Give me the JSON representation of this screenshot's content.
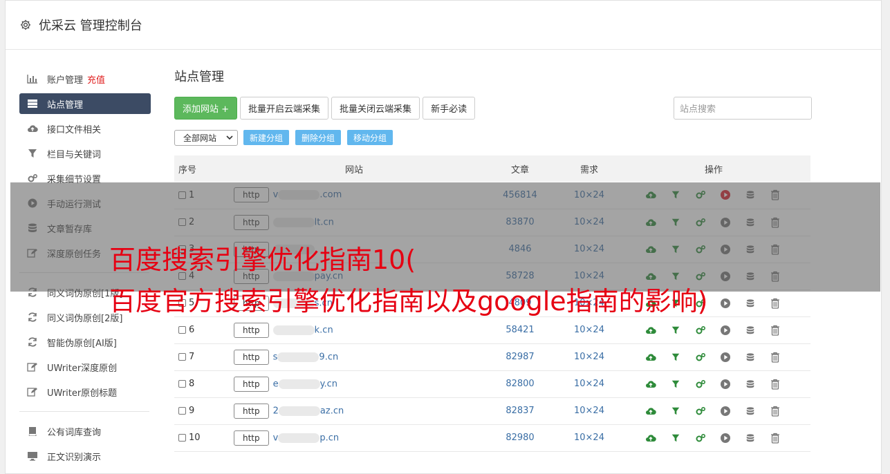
{
  "header": {
    "title": "优采云 管理控制台"
  },
  "sidebar": {
    "items": [
      {
        "label": "账户管理",
        "tag": "充值",
        "icon": "bar-chart-icon"
      },
      {
        "label": "站点管理",
        "icon": "server-icon",
        "active": true
      },
      {
        "label": "接口文件相关",
        "icon": "cloud-upload-icon"
      },
      {
        "label": "栏目与关键词",
        "icon": "filter-icon"
      },
      {
        "label": "采集细节设置",
        "icon": "cogs-icon"
      },
      {
        "label": "手动运行测试",
        "icon": "play-circle-icon"
      },
      {
        "label": "文章暂存库",
        "icon": "database-icon"
      },
      {
        "label": "深度原创任务",
        "icon": "edit-icon"
      },
      {
        "label": "同义词伪原创[1版]",
        "icon": "refresh-icon"
      },
      {
        "label": "同义词伪原创[2版]",
        "icon": "refresh-icon"
      },
      {
        "label": "智能伪原创[AI版]",
        "icon": "refresh-icon"
      },
      {
        "label": "UWriter深度原创",
        "icon": "edit-icon"
      },
      {
        "label": "UWriter原创标题",
        "icon": "edit-icon"
      },
      {
        "label": "公有词库查询",
        "icon": "book-icon"
      },
      {
        "label": "正文识别演示",
        "icon": "monitor-icon"
      }
    ]
  },
  "main": {
    "title": "站点管理",
    "toolbar": {
      "add_site": "添加网站 +",
      "batch_open": "批量开启云端采集",
      "batch_close": "批量关闭云端采集",
      "guide": "新手必读",
      "search_placeholder": "站点搜索"
    },
    "filter": {
      "select_value": "全部网站",
      "new_group": "新建分组",
      "delete_group": "删除分组",
      "move_group": "移动分组"
    },
    "table": {
      "headers": {
        "num": "序号",
        "site": "网站",
        "articles": "文章",
        "demand": "需求",
        "ops": "操作"
      },
      "rows": [
        {
          "num": "1",
          "protocol": "http",
          "prefix": "v",
          "suffix": ".com",
          "articles": "456814",
          "demand": "10×24",
          "play_active": true
        },
        {
          "num": "2",
          "protocol": "http",
          "prefix": "",
          "suffix": "lt.cn",
          "articles": "83870",
          "demand": "10×24"
        },
        {
          "num": "3",
          "protocol": "http",
          "prefix": "",
          "suffix": "",
          "articles": "4846",
          "demand": "10×24"
        },
        {
          "num": "4",
          "protocol": "http",
          "prefix": "",
          "suffix": "pay.cn",
          "articles": "58728",
          "demand": "10×24"
        },
        {
          "num": "5",
          "protocol": "http",
          "prefix": "",
          "suffix": "s.cn",
          "articles": "4809",
          "demand": "10×24"
        },
        {
          "num": "6",
          "protocol": "http",
          "prefix": "",
          "suffix": "k.cn",
          "articles": "58421",
          "demand": "10×24"
        },
        {
          "num": "7",
          "protocol": "http",
          "prefix": "s",
          "suffix": "9.cn",
          "articles": "82987",
          "demand": "10×24"
        },
        {
          "num": "8",
          "protocol": "http",
          "prefix": "e",
          "suffix": "y.cn",
          "articles": "82800",
          "demand": "10×24"
        },
        {
          "num": "9",
          "protocol": "http",
          "prefix": "2",
          "suffix": "az.cn",
          "articles": "82837",
          "demand": "10×24"
        },
        {
          "num": "10",
          "protocol": "http",
          "prefix": "v",
          "suffix": "p.cn",
          "articles": "82980",
          "demand": "10×24"
        }
      ]
    }
  },
  "overlay": {
    "line1": "百度搜索引擎优化指南10(",
    "line2": "百度官方搜索引擎优化指南以及google指南的影响)"
  },
  "colors": {
    "sidebar_active": "#3c4b64",
    "add_button": "#5cb85c",
    "group_button": "#61b7ee",
    "headline": "#e60012",
    "tag": "#e02020"
  }
}
